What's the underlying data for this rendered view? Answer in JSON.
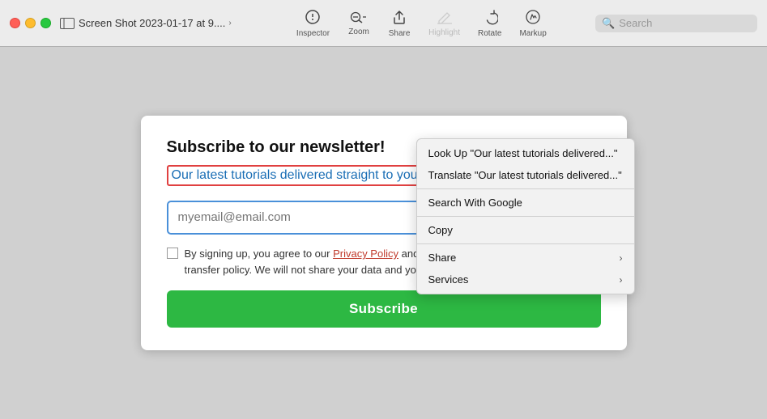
{
  "titlebar": {
    "title": "Screen Shot 2023-01-17 at 9....",
    "traffic_lights": [
      "red",
      "yellow",
      "green"
    ],
    "view_label": "View",
    "chevron": "›"
  },
  "toolbar": {
    "inspector_label": "Inspector",
    "zoom_label": "Zoom",
    "share_label": "Share",
    "highlight_label": "Highlight",
    "rotate_label": "Rotate",
    "markup_label": "Markup",
    "search_placeholder": "Search"
  },
  "newsletter": {
    "title": "Subscribe to our newsletter!",
    "subtitle": "Our latest tutorials delivered straight to your inbox",
    "email_placeholder": "myemail@email.com",
    "policy_text_before": "By signing up, you agree to our",
    "policy_link": "Privacy Policy",
    "policy_text_after": "and European users agree to the data transfer policy. We will not share your data and you can unsubscribe at any time.",
    "subscribe_button": "Subscribe"
  },
  "context_menu": {
    "items": [
      {
        "label": "Look Up \"Our latest tutorials delivered...\"",
        "has_arrow": false
      },
      {
        "label": "Translate \"Our latest tutorials delivered...\"",
        "has_arrow": false
      },
      {
        "label": "Search With Google",
        "has_arrow": false
      },
      {
        "label": "Copy",
        "has_arrow": false
      },
      {
        "label": "Share",
        "has_arrow": true
      },
      {
        "label": "Services",
        "has_arrow": true
      }
    ]
  }
}
